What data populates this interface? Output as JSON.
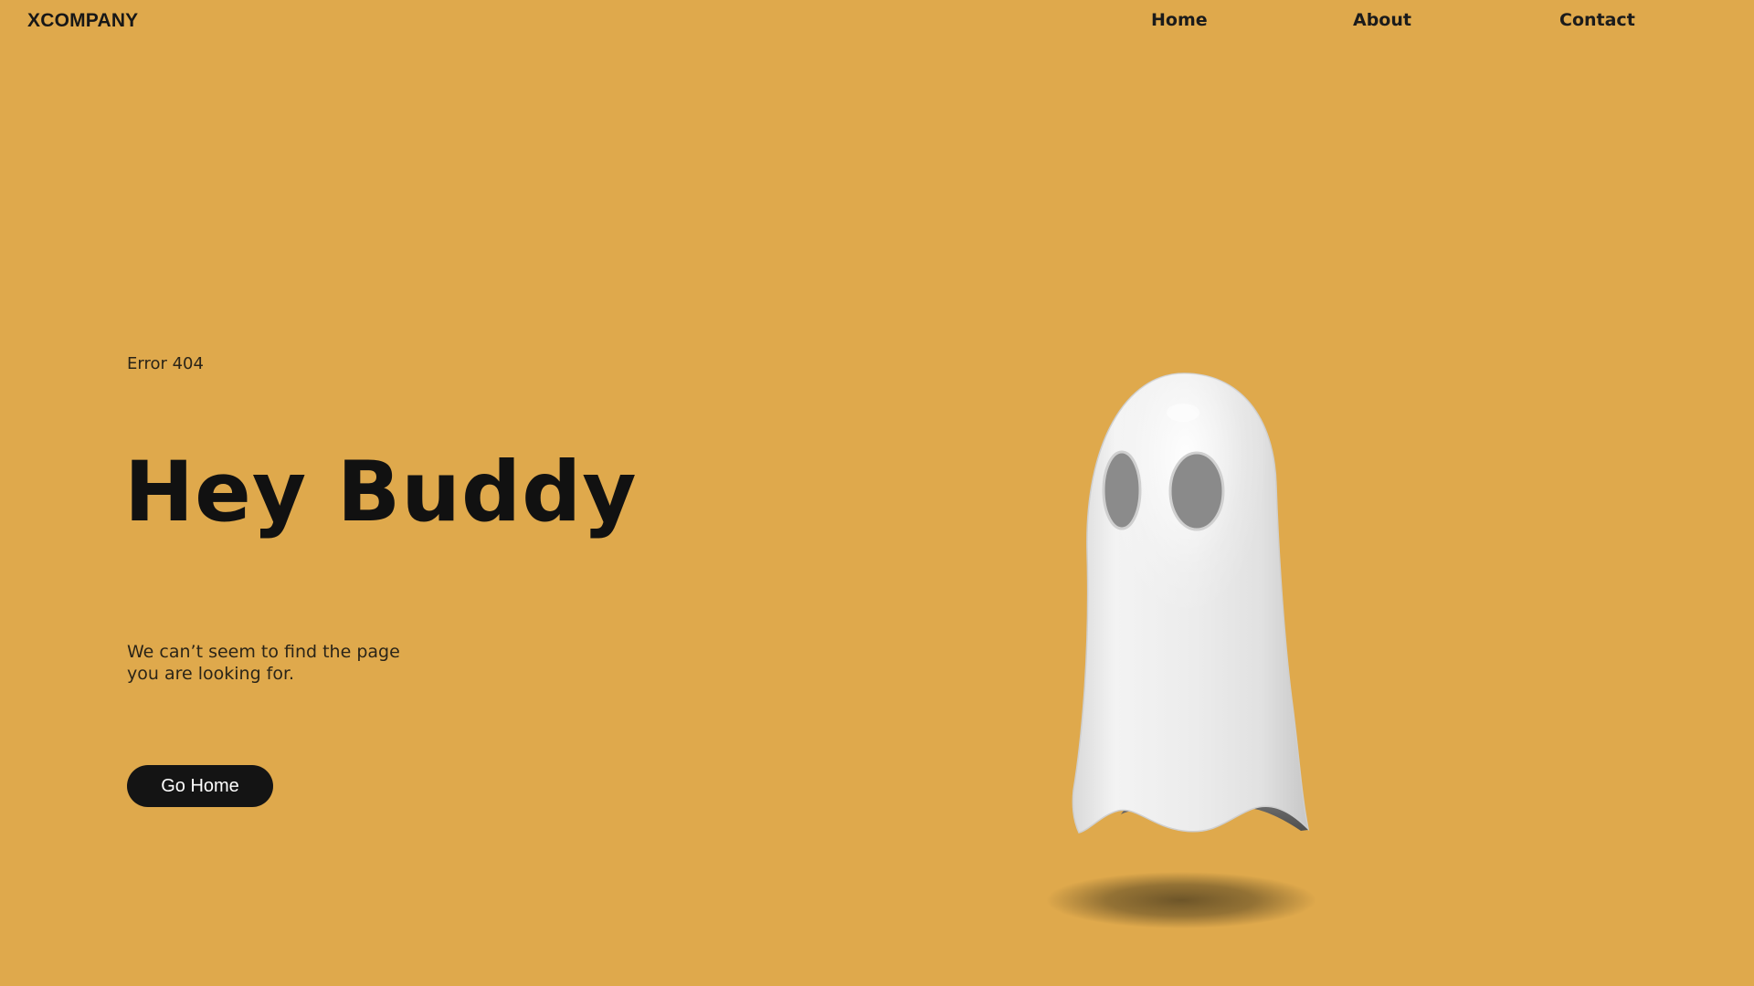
{
  "header": {
    "brand": "XCOMPANY",
    "nav": {
      "home": "Home",
      "about": "About",
      "contact": "Contact"
    }
  },
  "hero": {
    "eyebrow": "Error 404",
    "title": "Hey Buddy",
    "message_line_1": "We can’t seem to find the page",
    "message_line_2": "you are looking for.",
    "button_label": "Go Home"
  },
  "theme": {
    "background": "#dfa94c",
    "text": "#171717",
    "button": "#141414",
    "button_text": "#ffffff"
  },
  "illustration": {
    "type": "ghost-icon"
  }
}
